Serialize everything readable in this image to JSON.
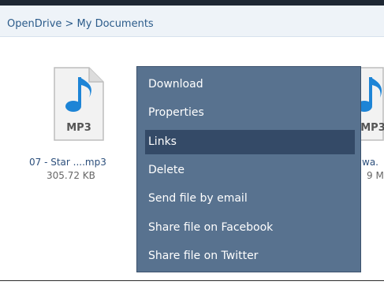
{
  "breadcrumb": "OpenDrive > My Documents",
  "files": [
    {
      "badge": "MP3",
      "name": "07 - Star ....mp3",
      "size": "305.72 KB"
    },
    {
      "badge": "MP3",
      "name": "wa.",
      "size": "9 M"
    }
  ],
  "menu": {
    "items": [
      {
        "label": "Download"
      },
      {
        "label": "Properties"
      },
      {
        "label": "Links"
      },
      {
        "label": "Delete"
      },
      {
        "label": "Send file by email"
      },
      {
        "label": "Share file on Facebook"
      },
      {
        "label": "Share file on Twitter"
      }
    ],
    "active_index": 2
  },
  "colors": {
    "menu_bg": "#58728f",
    "menu_active": "#344a67",
    "breadcrumb_bg": "#eef3f8",
    "note_blue": "#1d84d6"
  },
  "icons": [
    "mp3-file-icon",
    "music-note-icon"
  ]
}
